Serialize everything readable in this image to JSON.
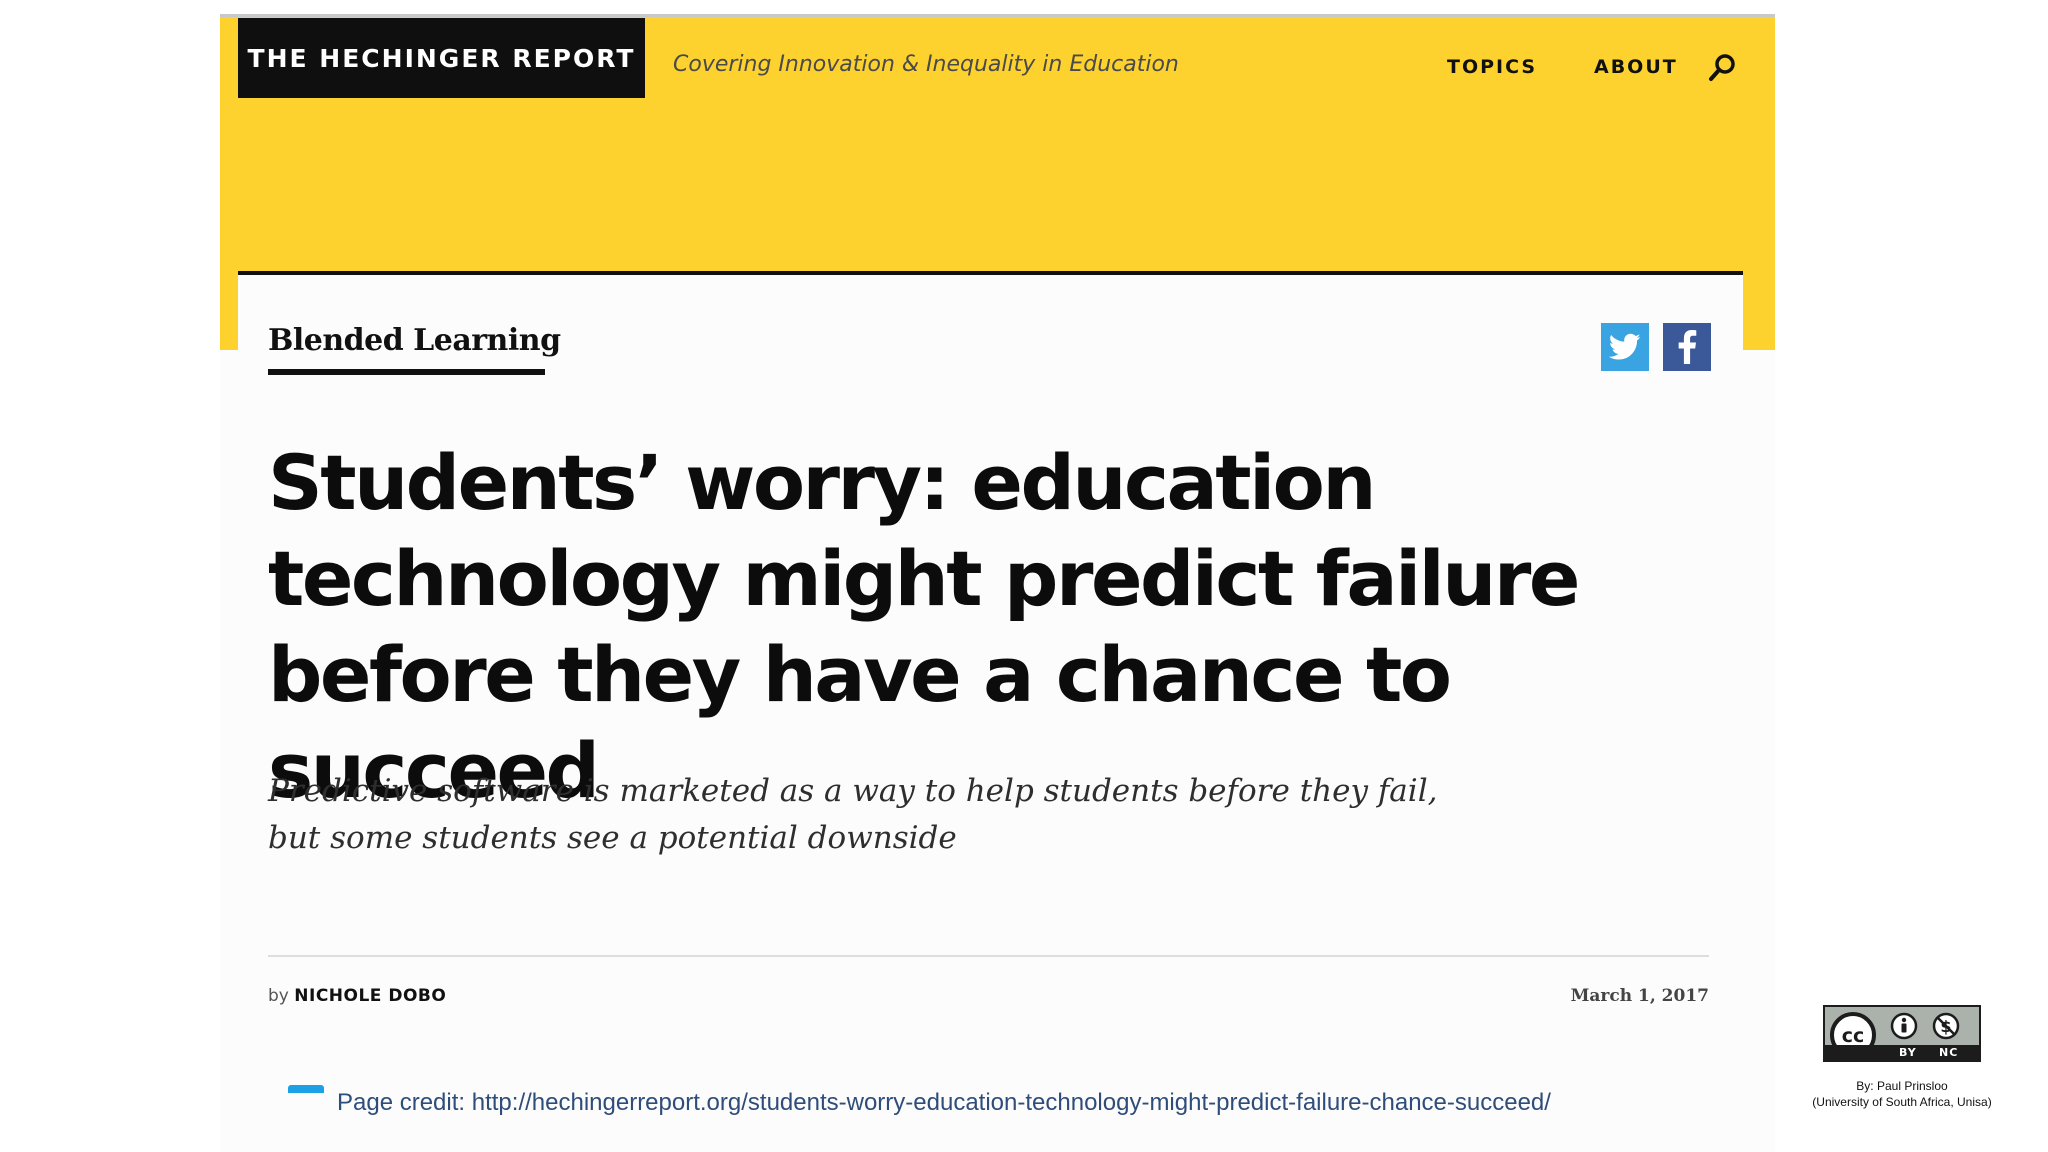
{
  "site": {
    "logo_text": "THE HECHINGER REPORT",
    "tagline": "Covering Innovation & Inequality in Education",
    "nav": [
      {
        "label": "TOPICS"
      },
      {
        "label": "ABOUT"
      }
    ],
    "search_icon": "search-icon"
  },
  "colors": {
    "header_yellow": "#fdd22f",
    "logo_bg": "#0f0f0f",
    "twitter_blue": "#3aa4e2",
    "facebook_blue": "#3b5998",
    "credit_text": "#2f4d7a"
  },
  "article": {
    "section": "Blended Learning",
    "headline": "Students’ worry: education technology might predict failure before they have a chance to succeed",
    "dek": "Predictive software is marketed as a way to help students before they fail, but some students see a potential downside",
    "byline_prefix": "by",
    "author": "NICHOLE DOBO",
    "date": "March 1, 2017",
    "share_icons": [
      "twitter-icon",
      "facebook-icon"
    ]
  },
  "slide": {
    "page_credit": "Page credit: http://hechingerreport.org/students-worry-education-technology-might-predict-failure-chance-succeed/",
    "license": {
      "icons": [
        "creative-commons-icon",
        "attribution-icon",
        "noncommercial-icon"
      ],
      "badge_labels": [
        "BY",
        "NC"
      ],
      "cc_glyph": "cc"
    },
    "author_line1": "By: Paul Prinsloo",
    "author_line2": "(University of South Africa, Unisa)"
  }
}
